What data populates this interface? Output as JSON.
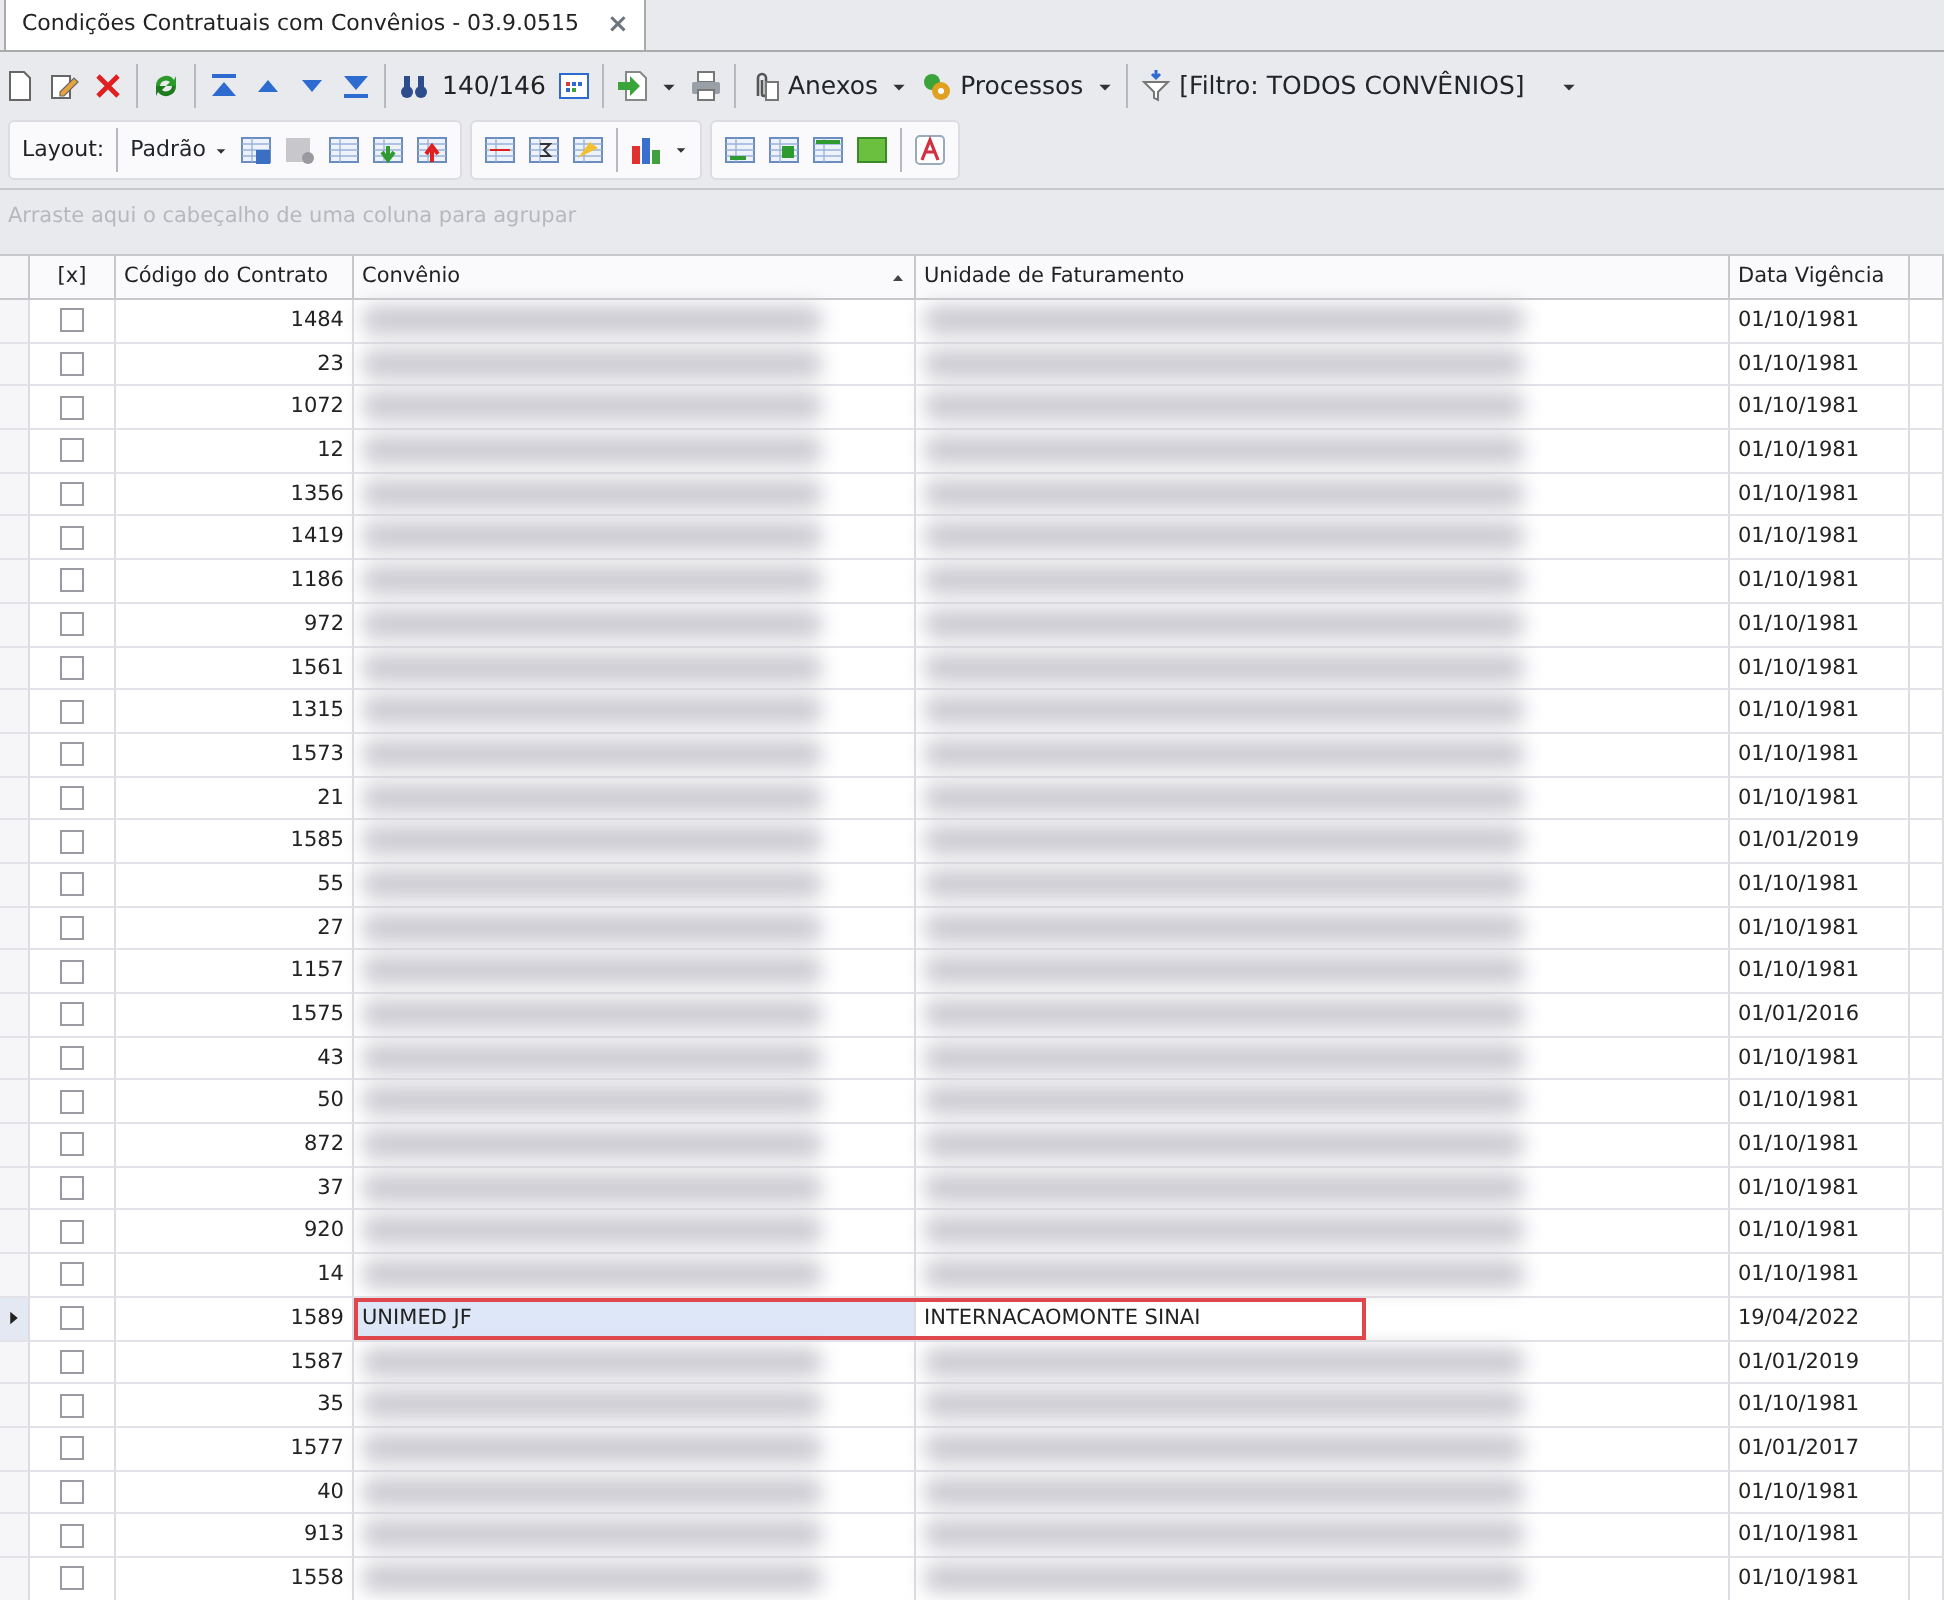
{
  "tab": {
    "title": "Condições Contratuais com Convênios - 03.9.0515",
    "close": "×"
  },
  "toolbar": {
    "counter": "140/146",
    "anexos": "Anexos",
    "processos": "Processos",
    "filter": "[Filtro: TODOS CONVÊNIOS]"
  },
  "layout_bar": {
    "label": "Layout:",
    "preset": "Padrão"
  },
  "group_panel": {
    "placeholder": "Arraste aqui o cabeçalho de uma coluna para agrupar"
  },
  "table": {
    "columns": [
      {
        "label": "[x]"
      },
      {
        "label": "Código do Contrato"
      },
      {
        "label": "Convênio",
        "sorted": true
      },
      {
        "label": "Unidade de Faturamento"
      },
      {
        "label": "Data Vigência"
      }
    ],
    "rows": [
      {
        "code": "1484",
        "date": "01/10/1981",
        "checked": false,
        "selected": false
      },
      {
        "code": "23",
        "date": "01/10/1981",
        "checked": false,
        "selected": false
      },
      {
        "code": "1072",
        "date": "01/10/1981",
        "checked": false,
        "selected": false
      },
      {
        "code": "12",
        "date": "01/10/1981",
        "checked": false,
        "selected": false
      },
      {
        "code": "1356",
        "date": "01/10/1981",
        "checked": false,
        "selected": false
      },
      {
        "code": "1419",
        "date": "01/10/1981",
        "checked": false,
        "selected": false
      },
      {
        "code": "1186",
        "date": "01/10/1981",
        "checked": false,
        "selected": false
      },
      {
        "code": "972",
        "date": "01/10/1981",
        "checked": false,
        "selected": false
      },
      {
        "code": "1561",
        "date": "01/10/1981",
        "checked": false,
        "selected": false
      },
      {
        "code": "1315",
        "date": "01/10/1981",
        "checked": false,
        "selected": false
      },
      {
        "code": "1573",
        "date": "01/10/1981",
        "checked": false,
        "selected": false
      },
      {
        "code": "21",
        "date": "01/10/1981",
        "checked": false,
        "selected": false
      },
      {
        "code": "1585",
        "date": "01/01/2019",
        "checked": false,
        "selected": false
      },
      {
        "code": "55",
        "date": "01/10/1981",
        "checked": false,
        "selected": false
      },
      {
        "code": "27",
        "date": "01/10/1981",
        "checked": false,
        "selected": false
      },
      {
        "code": "1157",
        "date": "01/10/1981",
        "checked": false,
        "selected": false
      },
      {
        "code": "1575",
        "date": "01/01/2016",
        "checked": false,
        "selected": false
      },
      {
        "code": "43",
        "date": "01/10/1981",
        "checked": false,
        "selected": false
      },
      {
        "code": "50",
        "date": "01/10/1981",
        "checked": false,
        "selected": false
      },
      {
        "code": "872",
        "date": "01/10/1981",
        "checked": false,
        "selected": false
      },
      {
        "code": "37",
        "date": "01/10/1981",
        "checked": false,
        "selected": false
      },
      {
        "code": "920",
        "date": "01/10/1981",
        "checked": false,
        "selected": false
      },
      {
        "code": "14",
        "date": "01/10/1981",
        "checked": false,
        "selected": false
      },
      {
        "code": "1589",
        "convenio": "UNIMED JF",
        "unidade": "INTERNACAOMONTE SINAI",
        "date": "19/04/2022",
        "checked": false,
        "selected": true
      },
      {
        "code": "1587",
        "date": "01/01/2019",
        "checked": false,
        "selected": false
      },
      {
        "code": "35",
        "date": "01/10/1981",
        "checked": false,
        "selected": false
      },
      {
        "code": "1577",
        "date": "01/01/2017",
        "checked": false,
        "selected": false
      },
      {
        "code": "40",
        "date": "01/10/1981",
        "checked": false,
        "selected": false
      },
      {
        "code": "913",
        "date": "01/10/1981",
        "checked": false,
        "selected": false
      },
      {
        "code": "1558",
        "date": "01/10/1981",
        "checked": false,
        "selected": false
      }
    ]
  }
}
